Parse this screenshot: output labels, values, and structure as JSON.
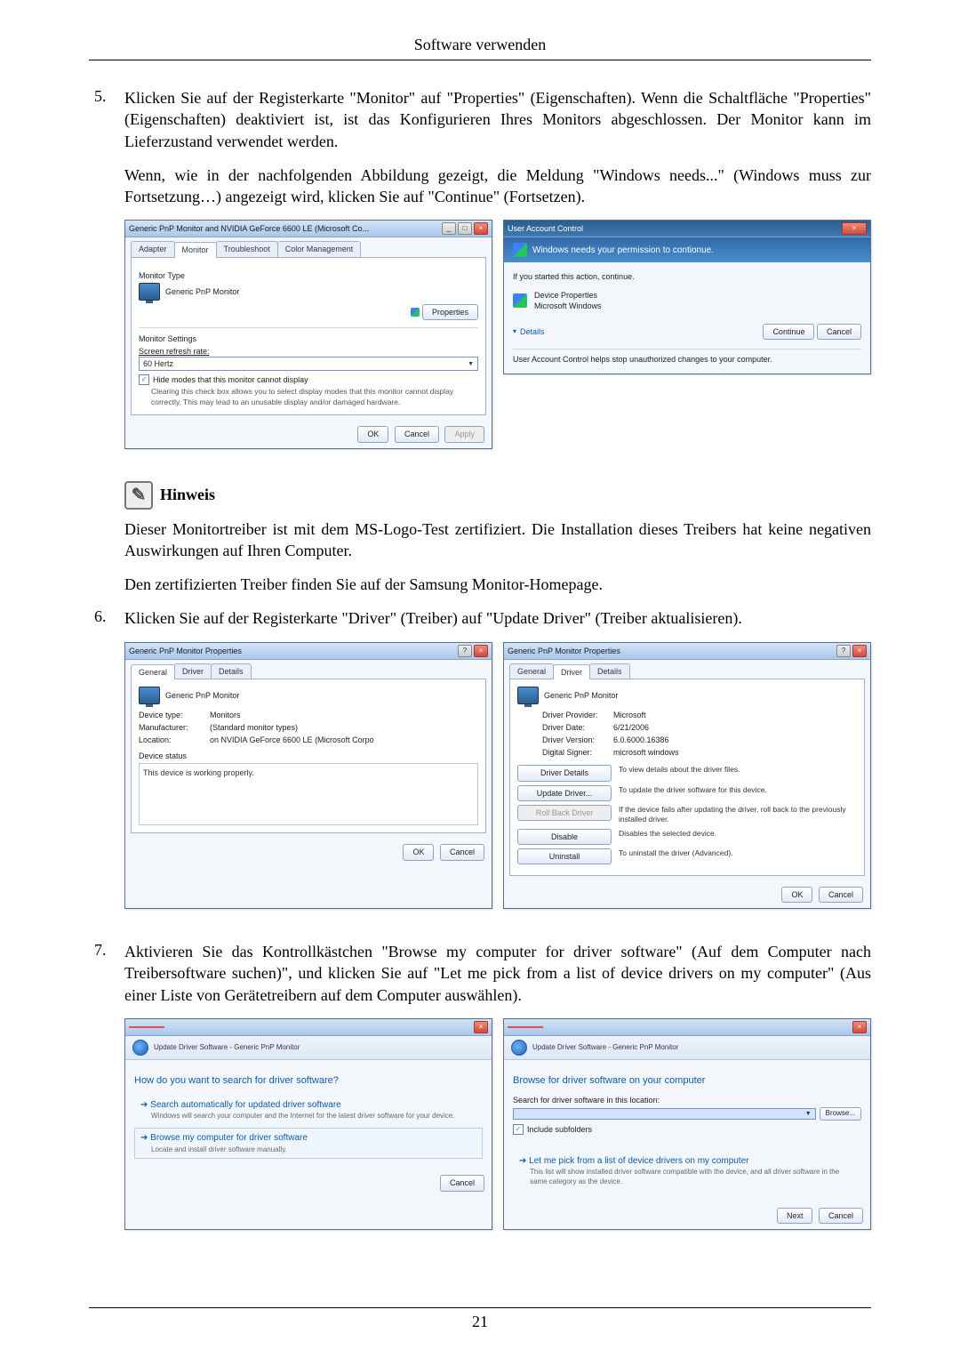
{
  "header": "Software verwenden",
  "pagenum": "21",
  "step5": {
    "num": "5.",
    "p1": "Klicken Sie auf der Registerkarte \"Monitor\" auf \"Properties\" (Eigenschaften). Wenn die Schaltfläche \"Properties\" (Eigenschaften) deaktiviert ist, ist das Konfigurieren Ihres Monitors abgeschlossen. Der Monitor kann im Lieferzustand verwendet werden.",
    "p2": "Wenn, wie in der nachfolgenden Abbildung gezeigt, die Meldung \"Windows needs...\" (Windows muss zur Fortsetzung…) angezeigt wird, klicken Sie auf \"Continue\" (Fortsetzen)."
  },
  "hinweis": {
    "title": "Hinweis",
    "p1": "Dieser Monitortreiber ist mit dem MS-Logo-Test zertifiziert. Die Installation dieses Treibers hat keine negativen Auswirkungen auf Ihren Computer.",
    "p2": "Den zertifizierten Treiber finden Sie auf der Samsung Monitor-Homepage."
  },
  "step6": {
    "num": "6.",
    "text": "Klicken Sie auf der Registerkarte \"Driver\" (Treiber) auf \"Update Driver\" (Treiber aktualisieren)."
  },
  "step7": {
    "num": "7.",
    "text": "Aktivieren Sie das Kontrollkästchen \"Browse my computer for driver software\" (Auf dem Computer nach Treibersoftware suchen)\", und klicken Sie auf \"Let me pick from a list of device drivers on my computer\" (Aus einer Liste von Gerätetreibern auf dem Computer auswählen)."
  },
  "dlg_monitor_settings": {
    "title": "Generic PnP Monitor and NVIDIA GeForce 6600 LE (Microsoft Co...",
    "tabs": [
      "Adapter",
      "Monitor",
      "Troubleshoot",
      "Color Management"
    ],
    "active_tab": 1,
    "monitor_type_label": "Monitor Type",
    "monitor_name": "Generic PnP Monitor",
    "properties_btn": "Properties",
    "monitor_settings_label": "Monitor Settings",
    "refresh_label": "Screen refresh rate:",
    "refresh_value": "60 Hertz",
    "hide_modes_chk": "Hide modes that this monitor cannot display",
    "hide_modes_desc": "Clearing this check box allows you to select display modes that this monitor cannot display correctly. This may lead to an unusable display and/or damaged hardware.",
    "ok": "OK",
    "cancel": "Cancel",
    "apply": "Apply"
  },
  "dlg_uac": {
    "title": "User Account Control",
    "banner": "Windows needs your permission to contionue.",
    "ifyou": "If you started this action, continue.",
    "app": "Device Properties",
    "publisher": "Microsoft Windows",
    "details": "Details",
    "continue": "Continue",
    "cancel": "Cancel",
    "footer": "User Account Control helps stop unauthorized changes to your computer."
  },
  "dlg_props_general": {
    "title": "Generic PnP Monitor Properties",
    "tabs": [
      "General",
      "Driver",
      "Details"
    ],
    "active_tab": 0,
    "name": "Generic PnP Monitor",
    "kv": [
      {
        "k": "Device type:",
        "v": "Monitors"
      },
      {
        "k": "Manufacturer:",
        "v": "(Standard monitor types)"
      },
      {
        "k": "Location:",
        "v": "on NVIDIA GeForce 6600 LE (Microsoft Corpo"
      }
    ],
    "status_label": "Device status",
    "status_text": "This device is working properly.",
    "ok": "OK",
    "cancel": "Cancel"
  },
  "dlg_props_driver": {
    "title": "Generic PnP Monitor Properties",
    "tabs": [
      "General",
      "Driver",
      "Details"
    ],
    "active_tab": 1,
    "name": "Generic PnP Monitor",
    "kv": [
      {
        "k": "Driver Provider:",
        "v": "Microsoft"
      },
      {
        "k": "Driver Date:",
        "v": "6/21/2006"
      },
      {
        "k": "Driver Version:",
        "v": "6.0.6000.16386"
      },
      {
        "k": "Digital Signer:",
        "v": "microsoft windows"
      }
    ],
    "buttons": [
      {
        "label": "Driver Details",
        "desc": "To view details about the driver files.",
        "disabled": false
      },
      {
        "label": "Update Driver...",
        "desc": "To update the driver software for this device.",
        "disabled": false
      },
      {
        "label": "Roll Back Driver",
        "desc": "If the device fails after updating the driver, roll back to the previously installed driver.",
        "disabled": true
      },
      {
        "label": "Disable",
        "desc": "Disables the selected device.",
        "disabled": false
      },
      {
        "label": "Uninstall",
        "desc": "To uninstall the driver (Advanced).",
        "disabled": false
      }
    ],
    "ok": "OK",
    "cancel": "Cancel"
  },
  "dlg_update1": {
    "crumb": "Update Driver Software - Generic PnP Monitor",
    "heading": "How do you want to search for driver software?",
    "opt1": "Search automatically for updated driver software",
    "opt1_sub": "Windows will search your computer and the Internet for the latest driver software for your device.",
    "opt2": "Browse my computer for driver software",
    "opt2_sub": "Locate and install driver software manually.",
    "cancel": "Cancel"
  },
  "dlg_update2": {
    "crumb": "Update Driver Software - Generic PnP Monitor",
    "heading": "Browse for driver software on your computer",
    "search_label": "Search for driver software in this location:",
    "browse": "Browse...",
    "include_sub": "Include subfolders",
    "letme": "Let me pick from a list of device drivers on my computer",
    "letme_sub": "This list will show installed driver software compatible with the device, and all driver software in the same category as the device.",
    "next": "Next",
    "cancel": "Cancel"
  }
}
